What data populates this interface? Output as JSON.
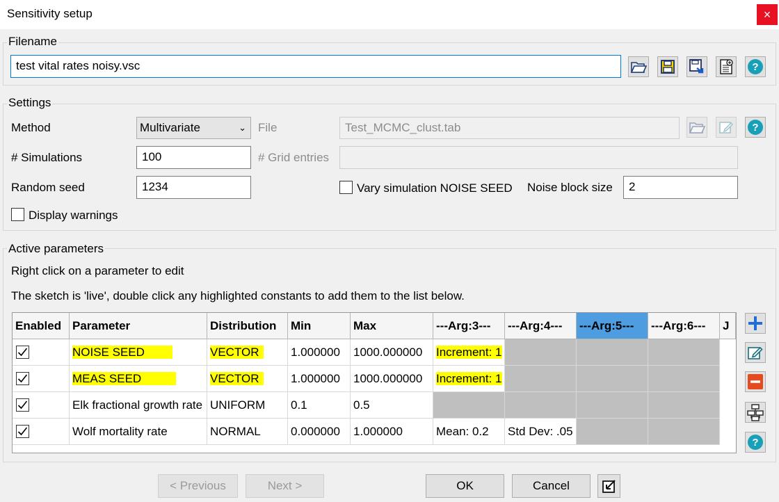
{
  "window": {
    "title": "Sensitivity setup",
    "close_label": "×"
  },
  "filename": {
    "group_title": "Filename",
    "value": "test vital rates noisy.vsc",
    "icons": [
      "open-folder-icon",
      "save-icon",
      "save-as-icon",
      "new-document-icon",
      "help-icon"
    ]
  },
  "settings": {
    "group_title": "Settings",
    "method_label": "Method",
    "method_value": "Multivariate",
    "file_label": "File",
    "file_value": "Test_MCMC_clust.tab",
    "simulations_label": "# Simulations",
    "simulations_value": "100",
    "grid_entries_label": "# Grid entries",
    "grid_entries_value": "",
    "random_seed_label": "Random seed",
    "random_seed_value": "1234",
    "vary_noise_label": "Vary simulation NOISE SEED",
    "vary_noise_checked": false,
    "noise_block_label": "Noise block size",
    "noise_block_value": "2",
    "display_warnings_label": "Display warnings",
    "display_warnings_checked": false
  },
  "active": {
    "group_title": "Active parameters",
    "hint1": "Right click on a parameter to edit",
    "hint2": "The sketch is 'live', double click any highlighted constants to add them to the list below.",
    "columns": [
      "Enabled",
      "Parameter",
      "Distribution",
      "Min",
      "Max",
      "---Arg:3---",
      "---Arg:4---",
      "---Arg:5---",
      "---Arg:6---",
      "J"
    ],
    "selected_column": "---Arg:5---",
    "rows": [
      {
        "enabled": true,
        "parameter": "NOISE SEED",
        "distribution": "VECTOR",
        "min": "1.000000",
        "max": "1000.000000",
        "arg3": "Increment: 1",
        "arg4": "",
        "highlighted": true
      },
      {
        "enabled": true,
        "parameter": "MEAS SEED",
        "distribution": "VECTOR",
        "min": "1.000000",
        "max": "1000.000000",
        "arg3": "Increment: 1",
        "arg4": "",
        "highlighted": true
      },
      {
        "enabled": true,
        "parameter": "Elk fractional growth rate",
        "distribution": "UNIFORM",
        "min": "0.1",
        "max": "0.5",
        "arg3": "",
        "arg4": "",
        "highlighted": false
      },
      {
        "enabled": true,
        "parameter": "Wolf mortality rate",
        "distribution": "NORMAL",
        "min": "0.000000",
        "max": "1.000000",
        "arg3": "Mean: 0.2",
        "arg4": "Std Dev: .05",
        "highlighted": false
      }
    ],
    "side_icons": [
      "add-icon",
      "edit-icon",
      "remove-icon",
      "hierarchy-icon",
      "help-icon"
    ]
  },
  "footer": {
    "previous_label": "< Previous",
    "next_label": "Next >",
    "ok_label": "OK",
    "cancel_label": "Cancel"
  }
}
